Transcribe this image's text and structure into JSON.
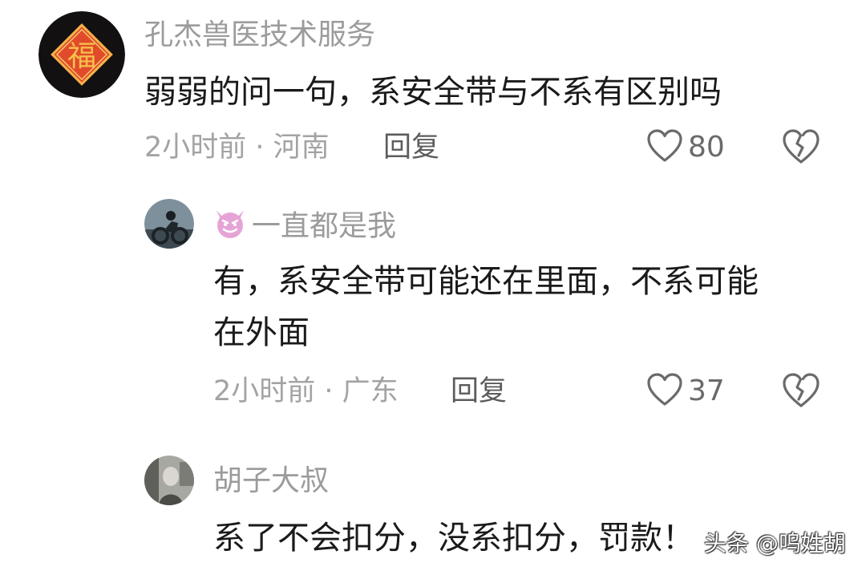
{
  "comments": [
    {
      "username": "孔杰兽医技术服务",
      "avatar": "fu-character-avatar",
      "text": "弱弱的问一句，系安全带与不系有区别吗",
      "meta": "2小时前 · 河南",
      "reply_label": "回复",
      "likes": "80"
    },
    {
      "username": "一直都是我",
      "username_badge": "smiling-devil-emoji",
      "avatar": "motorcycle-rider-avatar",
      "text_line1": "有，系安全带可能还在里面，不系可能",
      "text_line2": "在外面",
      "meta": "2小时前 · 广东",
      "reply_label": "回复",
      "likes": "37"
    },
    {
      "username": "胡子大叔",
      "avatar": "grayscale-photo-avatar",
      "text": "系了不会扣分，没系扣分，罚款！"
    }
  ],
  "watermark": "头条 @呜姓胡",
  "colors": {
    "username": "#9b9b9b",
    "text": "#1a1a1a",
    "meta": "#a3a3a3",
    "fu_red": "#e8502c"
  }
}
